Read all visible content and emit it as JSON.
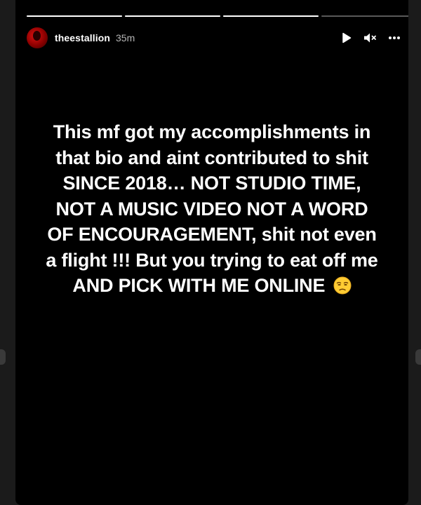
{
  "story": {
    "username": "theestallion",
    "time_ago": "35m",
    "progress": [
      1,
      1,
      1,
      0
    ],
    "text": "This mf got my accomplishments in that bio and aint contributed to shit SINCE 2018… NOT STUDIO TIME, NOT A MUSIC VIDEO NOT A WORD OF ENCOURAGEMENT, shit not even a flight !!! But you trying to eat off me AND PICK WITH ME ONLINE",
    "emoji": "unamused-face-emoji"
  },
  "icons": {
    "play": "play-icon",
    "mute": "mute-icon",
    "more": "more-icon"
  },
  "colors": {
    "background": "#000000",
    "text": "#ffffff",
    "avatar": "#c40000"
  }
}
